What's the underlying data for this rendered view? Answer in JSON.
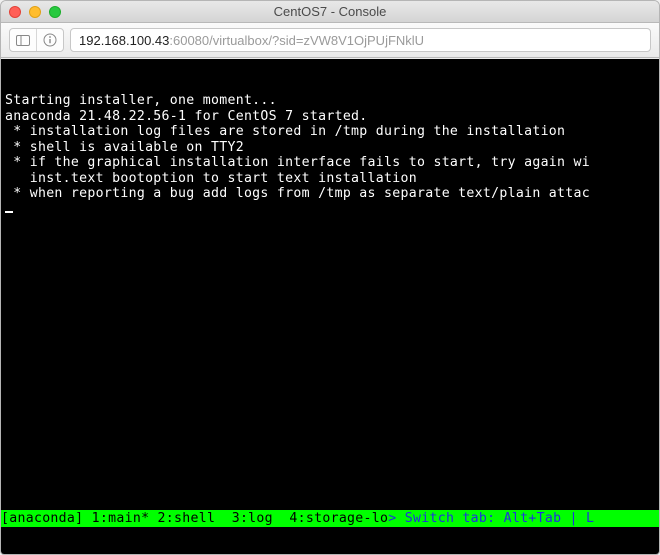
{
  "window": {
    "title": "CentOS7 - Console"
  },
  "toolbar": {
    "back_icon": "sidebar-icon",
    "info_icon": "info-icon"
  },
  "address": {
    "host": "192.168.100.43",
    "rest": ":60080/virtualbox/?sid=zVW8V1OjPUjFNklU"
  },
  "console": {
    "lines": [
      "Starting installer, one moment...",
      "anaconda 21.48.22.56-1 for CentOS 7 started.",
      " * installation log files are stored in /tmp during the installation",
      " * shell is available on TTY2",
      " * if the graphical installation interface fails to start, try again wi",
      "   inst.text bootoption to start text installation",
      " * when reporting a bug add logs from /tmp as separate text/plain attac"
    ]
  },
  "status": {
    "left": "[anaconda] 1:main* 2:shell  3:log  4:storage-lo",
    "sep": ">",
    "right": " Switch tab: Alt+Tab | L"
  }
}
